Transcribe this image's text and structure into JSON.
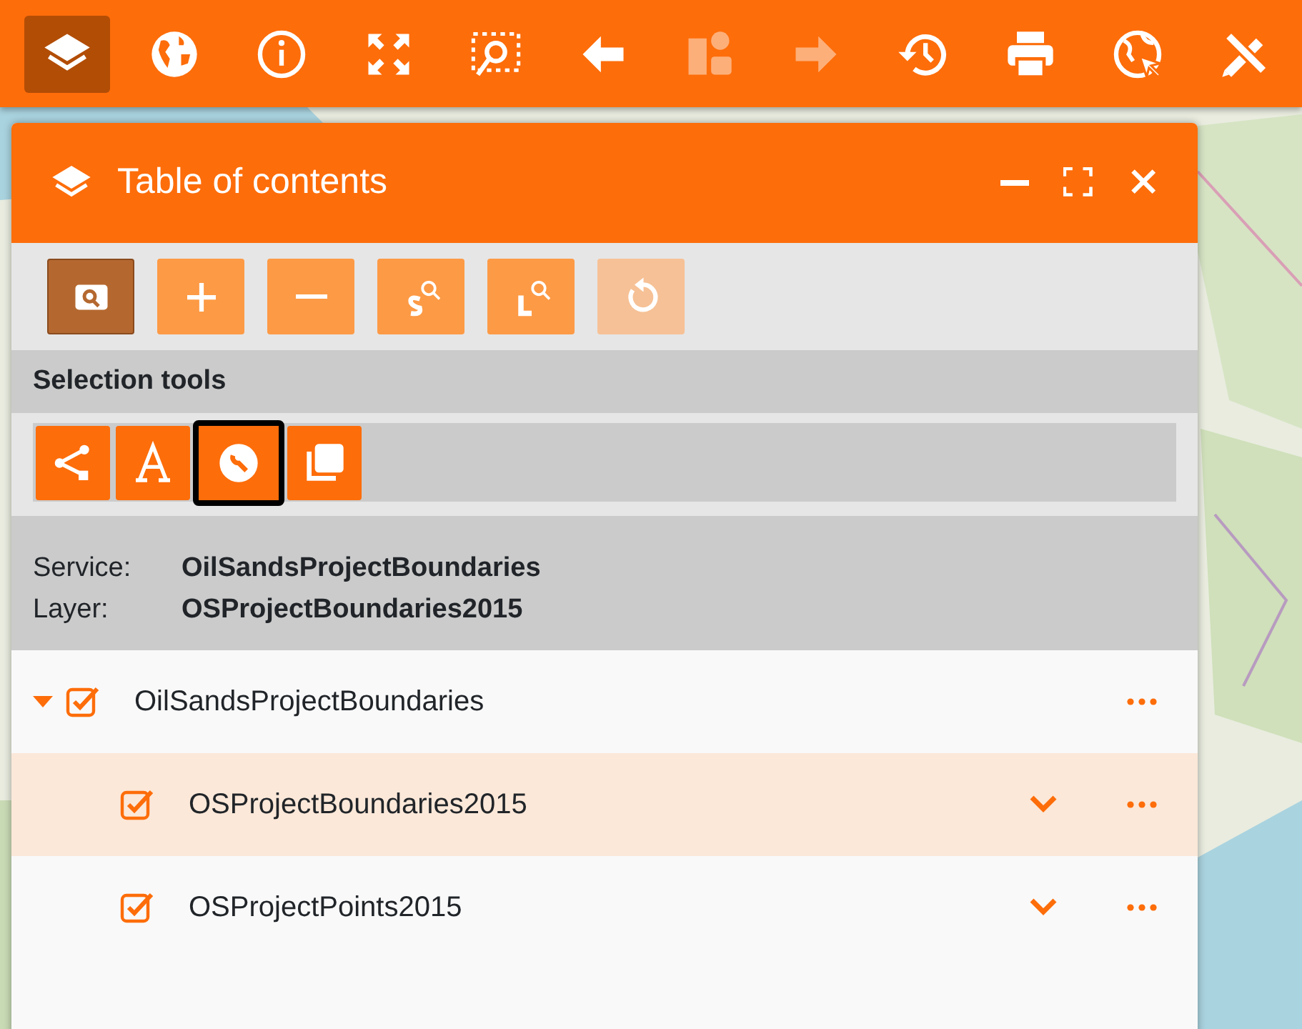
{
  "toolbar": [
    {
      "selected": true,
      "disabled": false
    },
    {
      "selected": false,
      "disabled": false
    },
    {
      "selected": false,
      "disabled": false
    },
    {
      "selected": false,
      "disabled": false
    },
    {
      "selected": false,
      "disabled": false
    },
    {
      "selected": false,
      "disabled": false
    },
    {
      "selected": false,
      "disabled": true
    },
    {
      "selected": false,
      "disabled": true
    },
    {
      "selected": false,
      "disabled": false
    },
    {
      "selected": false,
      "disabled": false
    },
    {
      "selected": false,
      "disabled": false
    },
    {
      "selected": false,
      "disabled": false
    }
  ],
  "panel": {
    "title": "Table of contents",
    "tools": [
      {
        "selected": true,
        "disabled": false
      },
      {
        "selected": false,
        "disabled": false
      },
      {
        "selected": false,
        "disabled": false
      },
      {
        "selected": false,
        "disabled": false
      },
      {
        "selected": false,
        "disabled": false
      },
      {
        "selected": false,
        "disabled": true
      }
    ],
    "selection_tools": {
      "title": "Selection tools",
      "buttons": [
        {
          "selected": false
        },
        {
          "selected": false
        },
        {
          "selected": true
        },
        {
          "selected": false
        }
      ]
    },
    "info": [
      {
        "label": "Service:",
        "value": "OilSandsProjectBoundaries"
      },
      {
        "label": "Layer:",
        "value": "OSProjectBoundaries2015"
      }
    ],
    "tree": [
      {
        "label": "OilSandsProjectBoundaries",
        "checked": true,
        "expanded": true,
        "selected": false,
        "children": [
          {
            "label": "OSProjectBoundaries2015",
            "checked": true,
            "selected": true
          },
          {
            "label": "OSProjectPoints2015",
            "checked": true,
            "selected": false
          }
        ]
      }
    ]
  }
}
